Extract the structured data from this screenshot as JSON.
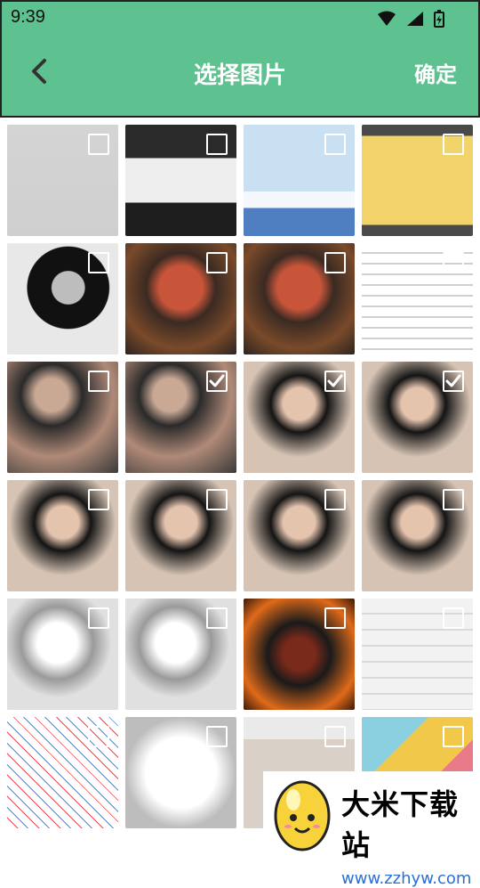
{
  "status_bar": {
    "time": "9:39"
  },
  "header": {
    "title": "选择图片",
    "back_label": "back",
    "confirm_label": "确定"
  },
  "grid": {
    "tiles": [
      {
        "name": "tile-1-gallery-placeholder",
        "checked": false
      },
      {
        "name": "tile-2-dialog-screenshot",
        "checked": false
      },
      {
        "name": "tile-3-airplane-app",
        "checked": false
      },
      {
        "name": "tile-4-privacy-dialog",
        "checked": false
      },
      {
        "name": "tile-5-bw-portrait",
        "checked": false
      },
      {
        "name": "tile-6-soldier-art",
        "checked": false
      },
      {
        "name": "tile-7-soldier-art",
        "checked": false
      },
      {
        "name": "tile-8-text-document",
        "checked": false
      },
      {
        "name": "tile-9-woman-dark",
        "checked": false
      },
      {
        "name": "tile-10-woman-dark",
        "checked": true
      },
      {
        "name": "tile-11-woman-portrait",
        "checked": true
      },
      {
        "name": "tile-12-woman-portrait",
        "checked": true
      },
      {
        "name": "tile-13-woman-portrait",
        "checked": false
      },
      {
        "name": "tile-14-woman-portrait",
        "checked": false
      },
      {
        "name": "tile-15-woman-portrait",
        "checked": false
      },
      {
        "name": "tile-16-woman-portrait",
        "checked": false
      },
      {
        "name": "tile-17-sketch-portrait",
        "checked": false
      },
      {
        "name": "tile-18-sketch-portrait",
        "checked": false
      },
      {
        "name": "tile-19-fire-warrior",
        "checked": false
      },
      {
        "name": "tile-20-list-screenshot",
        "checked": false
      },
      {
        "name": "tile-21-subway-map",
        "checked": false
      },
      {
        "name": "tile-22-white-dog",
        "checked": false
      },
      {
        "name": "tile-23-woman-fullbody",
        "checked": false
      },
      {
        "name": "tile-24-colorful-notes",
        "checked": false
      }
    ]
  },
  "watermark": {
    "title": "大米下载站",
    "url": "www.zzhyw.com"
  },
  "colors": {
    "header": "#5dc290",
    "title_text": "#ffffff"
  }
}
